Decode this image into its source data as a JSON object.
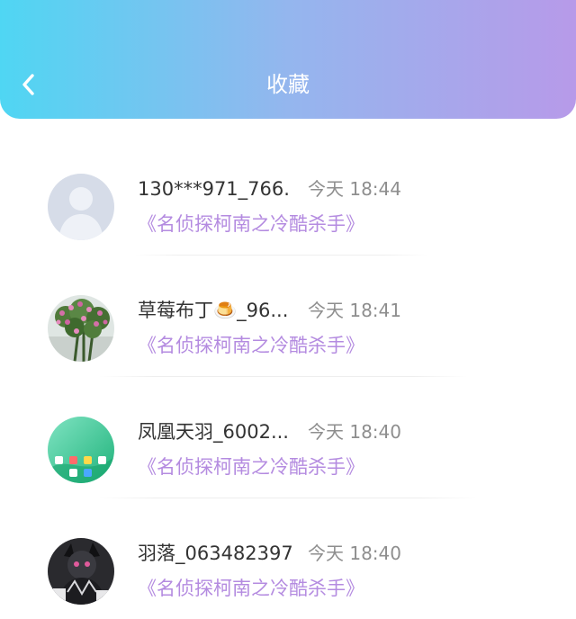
{
  "header": {
    "title": "收藏",
    "back_icon": "chevron-left-icon",
    "gradient": [
      "#4fd6f3",
      "#b79ae9"
    ]
  },
  "colors": {
    "title_accent": "#b48be0",
    "name_text": "#333333",
    "time_text": "#8e8e8e"
  },
  "list": {
    "items": [
      {
        "name": "130***971_766.",
        "time": "今天 18:44",
        "title": "《名侦探柯南之冷酷杀手》",
        "avatar": "default-user-avatar"
      },
      {
        "name": "草莓布丁🍮_96...",
        "time": "今天 18:41",
        "title": "《名侦探柯南之冷酷杀手》",
        "avatar": "flower-photo-avatar"
      },
      {
        "name": "凤凰天羽_6002...",
        "time": "今天 18:40",
        "title": "《名侦探柯南之冷酷杀手》",
        "avatar": "green-app-screen-avatar"
      },
      {
        "name": "羽落_063482397",
        "time": "今天 18:40",
        "title": "《名侦探柯南之冷酷杀手》",
        "avatar": "dark-anime-avatar"
      }
    ]
  }
}
